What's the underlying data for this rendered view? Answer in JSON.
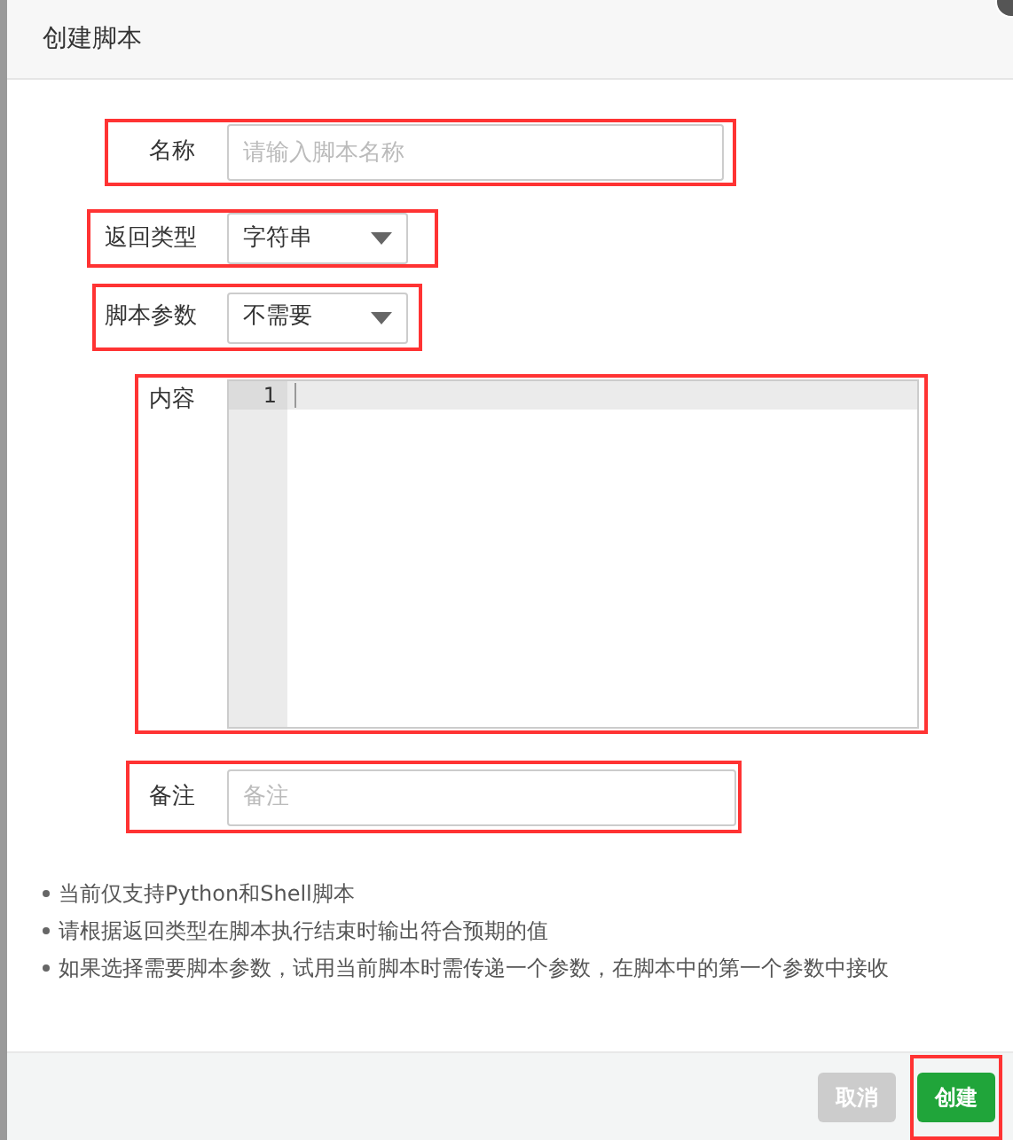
{
  "dialog": {
    "title": "创建脚本"
  },
  "fields": [
    {
      "kind": "text",
      "label": "名称",
      "placeholder": "请输入脚本名称",
      "highlighted": true
    },
    {
      "kind": "select",
      "label": "返回类型",
      "value": "字符串",
      "highlighted": true
    },
    {
      "kind": "select",
      "label": "脚本参数",
      "value": "不需要",
      "highlighted": true
    },
    {
      "kind": "editor",
      "label": "内容",
      "line_numbers": [
        "1"
      ],
      "highlighted": true
    },
    {
      "kind": "text",
      "label": "备注",
      "placeholder": "备注",
      "highlighted": true
    }
  ],
  "notes": [
    "当前仅支持Python和Shell脚本",
    "请根据返回类型在脚本执行结束时输出符合预期的值",
    "如果选择需要脚本参数，试用当前脚本时需传递一个参数，在脚本中的第一个参数中接收"
  ],
  "buttons": [
    {
      "label": "取消",
      "kind": "cancel",
      "highlighted": false
    },
    {
      "label": "创建",
      "kind": "primary",
      "highlighted": true
    }
  ]
}
